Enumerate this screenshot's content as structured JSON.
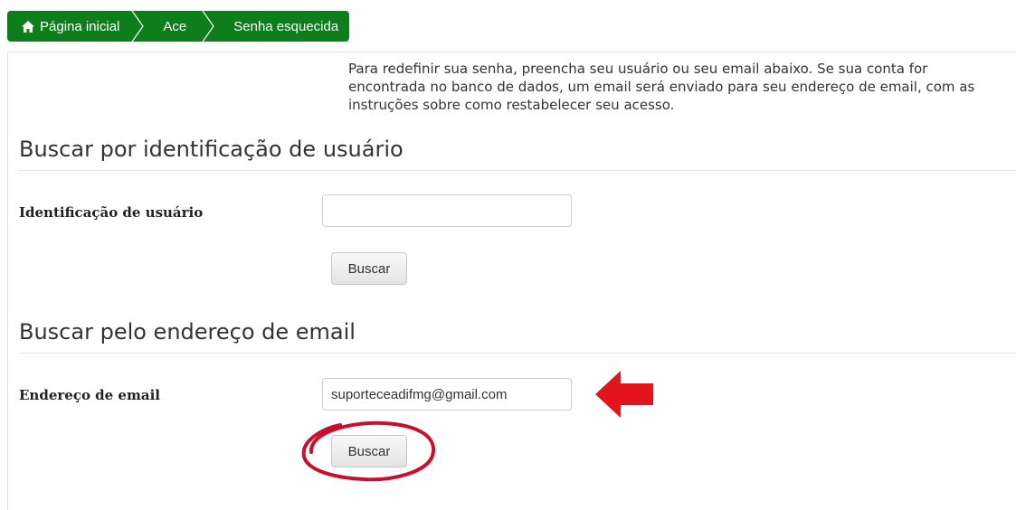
{
  "breadcrumb": {
    "items": [
      {
        "label": "Página inicial",
        "icon": "home-icon"
      },
      {
        "label": "Ace"
      },
      {
        "label": "Senha esquecida"
      }
    ],
    "color": "#0e7d1c"
  },
  "intro_text": "Para redefinir sua senha, preencha seu usuário ou seu email abaixo. Se sua conta for encontrada no banco de dados, um email será enviado para seu endereço de email, com as instruções sobre como restabelecer seu acesso.",
  "username_section": {
    "title": "Buscar por identificação de usuário",
    "field_label": "Identificação de usuário",
    "field_value": "",
    "button_label": "Buscar"
  },
  "email_section": {
    "title": "Buscar pelo endereço de email",
    "field_label": "Endereço de email",
    "field_value": "suporteceadifmg@gmail.com",
    "button_label": "Buscar"
  },
  "annotations": {
    "arrow_color": "#e3141b",
    "circle_color": "#c8102e"
  }
}
